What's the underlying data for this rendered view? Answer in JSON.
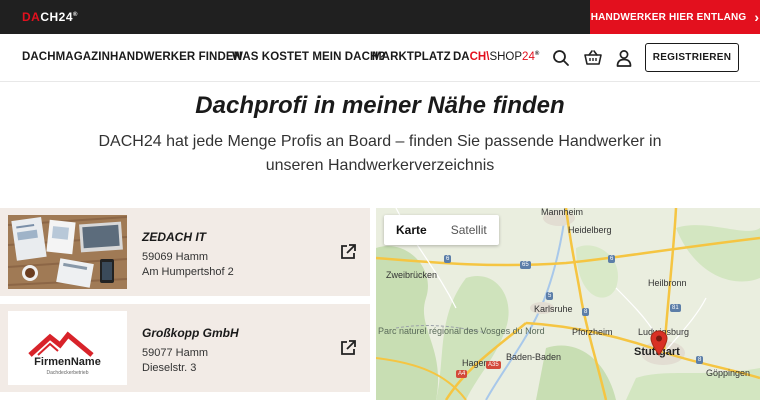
{
  "topbar": {
    "logo_a": "DA",
    "logo_b": "CH24",
    "logo_reg": "®",
    "craftsman_cta": "HANDWERKER HIER ENTLANG",
    "craftsman_arrow": "›"
  },
  "nav": {
    "items": [
      "DACHMAGAZIN",
      "HANDWERKER FINDEN",
      "WAS KOSTET MEIN DACH?",
      "MARKTPLATZ"
    ],
    "shop_a": "DA",
    "shop_b": "CH",
    "shop_sep": "\\",
    "shop_c": "SHOP",
    "shop_d": "24",
    "shop_reg": "®",
    "register": "REGISTRIEREN",
    "icons": [
      "search-icon",
      "basket-icon",
      "user-icon"
    ]
  },
  "hero": {
    "title": "Dachprofi in meiner Nähe finden",
    "subtitle": "DACH24 hat jede Menge Profis an Board – finden Sie passende Handwerker in unseren Handwerkerverzeichnis"
  },
  "listings": [
    {
      "name": "ZEDACH IT",
      "zip_city": "59069 Hamm",
      "street": "Am Humpertshof 2",
      "image": "office-desk-photo"
    },
    {
      "name": "Großkopp GmbH",
      "zip_city": "59077 Hamm",
      "street": "Dieselstr. 3",
      "image": "firmenname-logo",
      "logo_text": "FirmenName",
      "logo_sub": "Dachdeckerbetrieb"
    }
  ],
  "map": {
    "tabs": [
      "Karte",
      "Satellit"
    ],
    "active_tab": "Karte",
    "labels": [
      "Mannheim",
      "Heidelberg",
      "Zweibrücken",
      "Heilbronn",
      "Karlsruhe",
      "Pforzheim",
      "Ludwigsburg",
      "Stuttgart",
      "Hagenau",
      "Baden-Baden",
      "Göppingen"
    ],
    "region_label": "Parc naturel régional des Vosges du Nord",
    "road_shields": [
      "6",
      "65",
      "6",
      "81",
      "5",
      "8",
      "A4",
      "A35",
      "8"
    ],
    "colors": {
      "land": "#e8ecdc",
      "forest": "#c9dfb5",
      "road": "#f5c542",
      "marker": "#d93025"
    }
  }
}
